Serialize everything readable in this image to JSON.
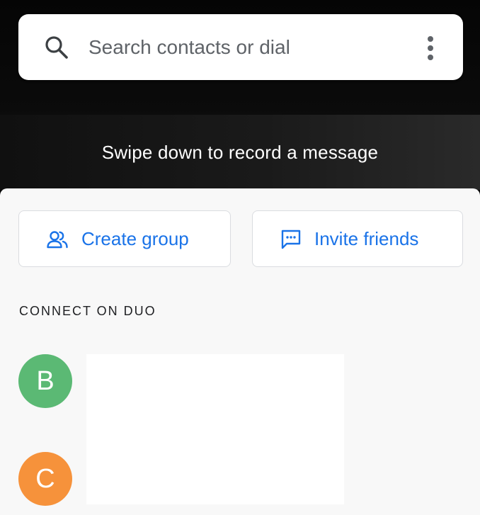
{
  "search": {
    "placeholder": "Search contacts or dial",
    "icon": "search-icon",
    "menu_icon": "more-vert-icon"
  },
  "swipe_hint": "Swipe down to record a message",
  "actions": {
    "create_group": {
      "label": "Create group",
      "icon": "group-icon"
    },
    "invite_friends": {
      "label": "Invite friends",
      "icon": "message-icon"
    }
  },
  "section": {
    "title": "CONNECT ON DUO"
  },
  "contacts": [
    {
      "initial": "B",
      "color": "#5bb974"
    },
    {
      "initial": "C",
      "color": "#f6923b"
    }
  ],
  "colors": {
    "accent": "#1a73e8",
    "sheet_background": "#f8f8f8"
  }
}
